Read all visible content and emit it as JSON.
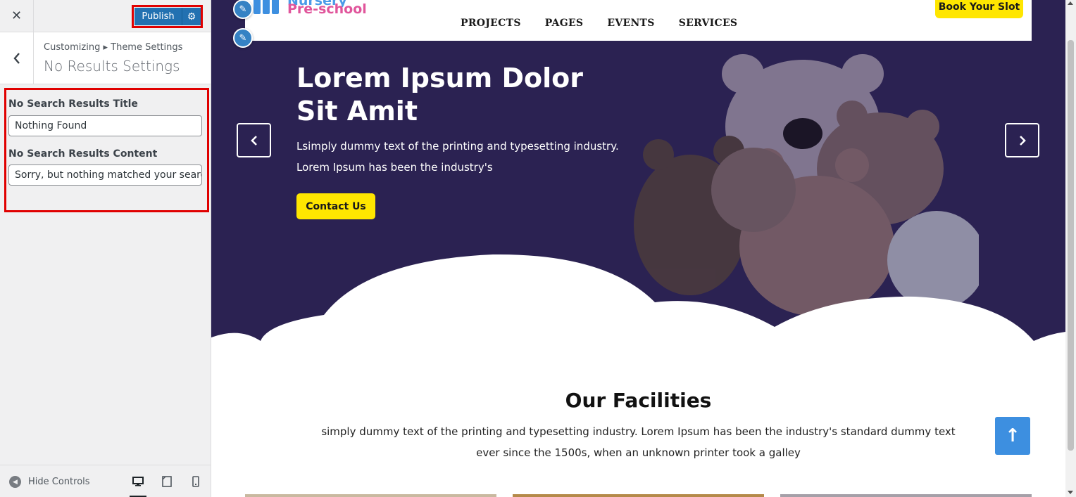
{
  "sidebar": {
    "close_icon": "close-icon",
    "publish_label": "Publish",
    "breadcrumb": "Customizing ▸ Theme Settings",
    "section_title": "No Results Settings",
    "fields": [
      {
        "label": "No Search Results Title",
        "value": "Nothing Found"
      },
      {
        "label": "No Search Results Content",
        "value": "Sorry, but nothing matched your search t"
      }
    ],
    "hide_controls_label": "Hide Controls",
    "highlight_color": "#e00000",
    "accent_color": "#2271b1"
  },
  "preview": {
    "logo": {
      "line1": "Nursery",
      "line2": "Pre-school"
    },
    "menu": [
      "PROJECTS",
      "PAGES",
      "EVENTS",
      "SERVICES"
    ],
    "book_button": "Book Your Slot",
    "hero": {
      "title": "Lorem Ipsum Dolor Sit Amit",
      "text": "Lsimply dummy text of the printing and typesetting industry. Lorem Ipsum has been the industry's",
      "button": "Contact Us",
      "background_color": "#2b2252",
      "button_color": "#ffe600"
    },
    "facilities": {
      "title": "Our Facilities",
      "text": "simply dummy text of the printing and typesetting industry. Lorem Ipsum has been the industry's standard dummy text ever since the 1500s, when an unknown printer took a galley"
    },
    "scroll_top_icon": "arrow-up-icon"
  }
}
